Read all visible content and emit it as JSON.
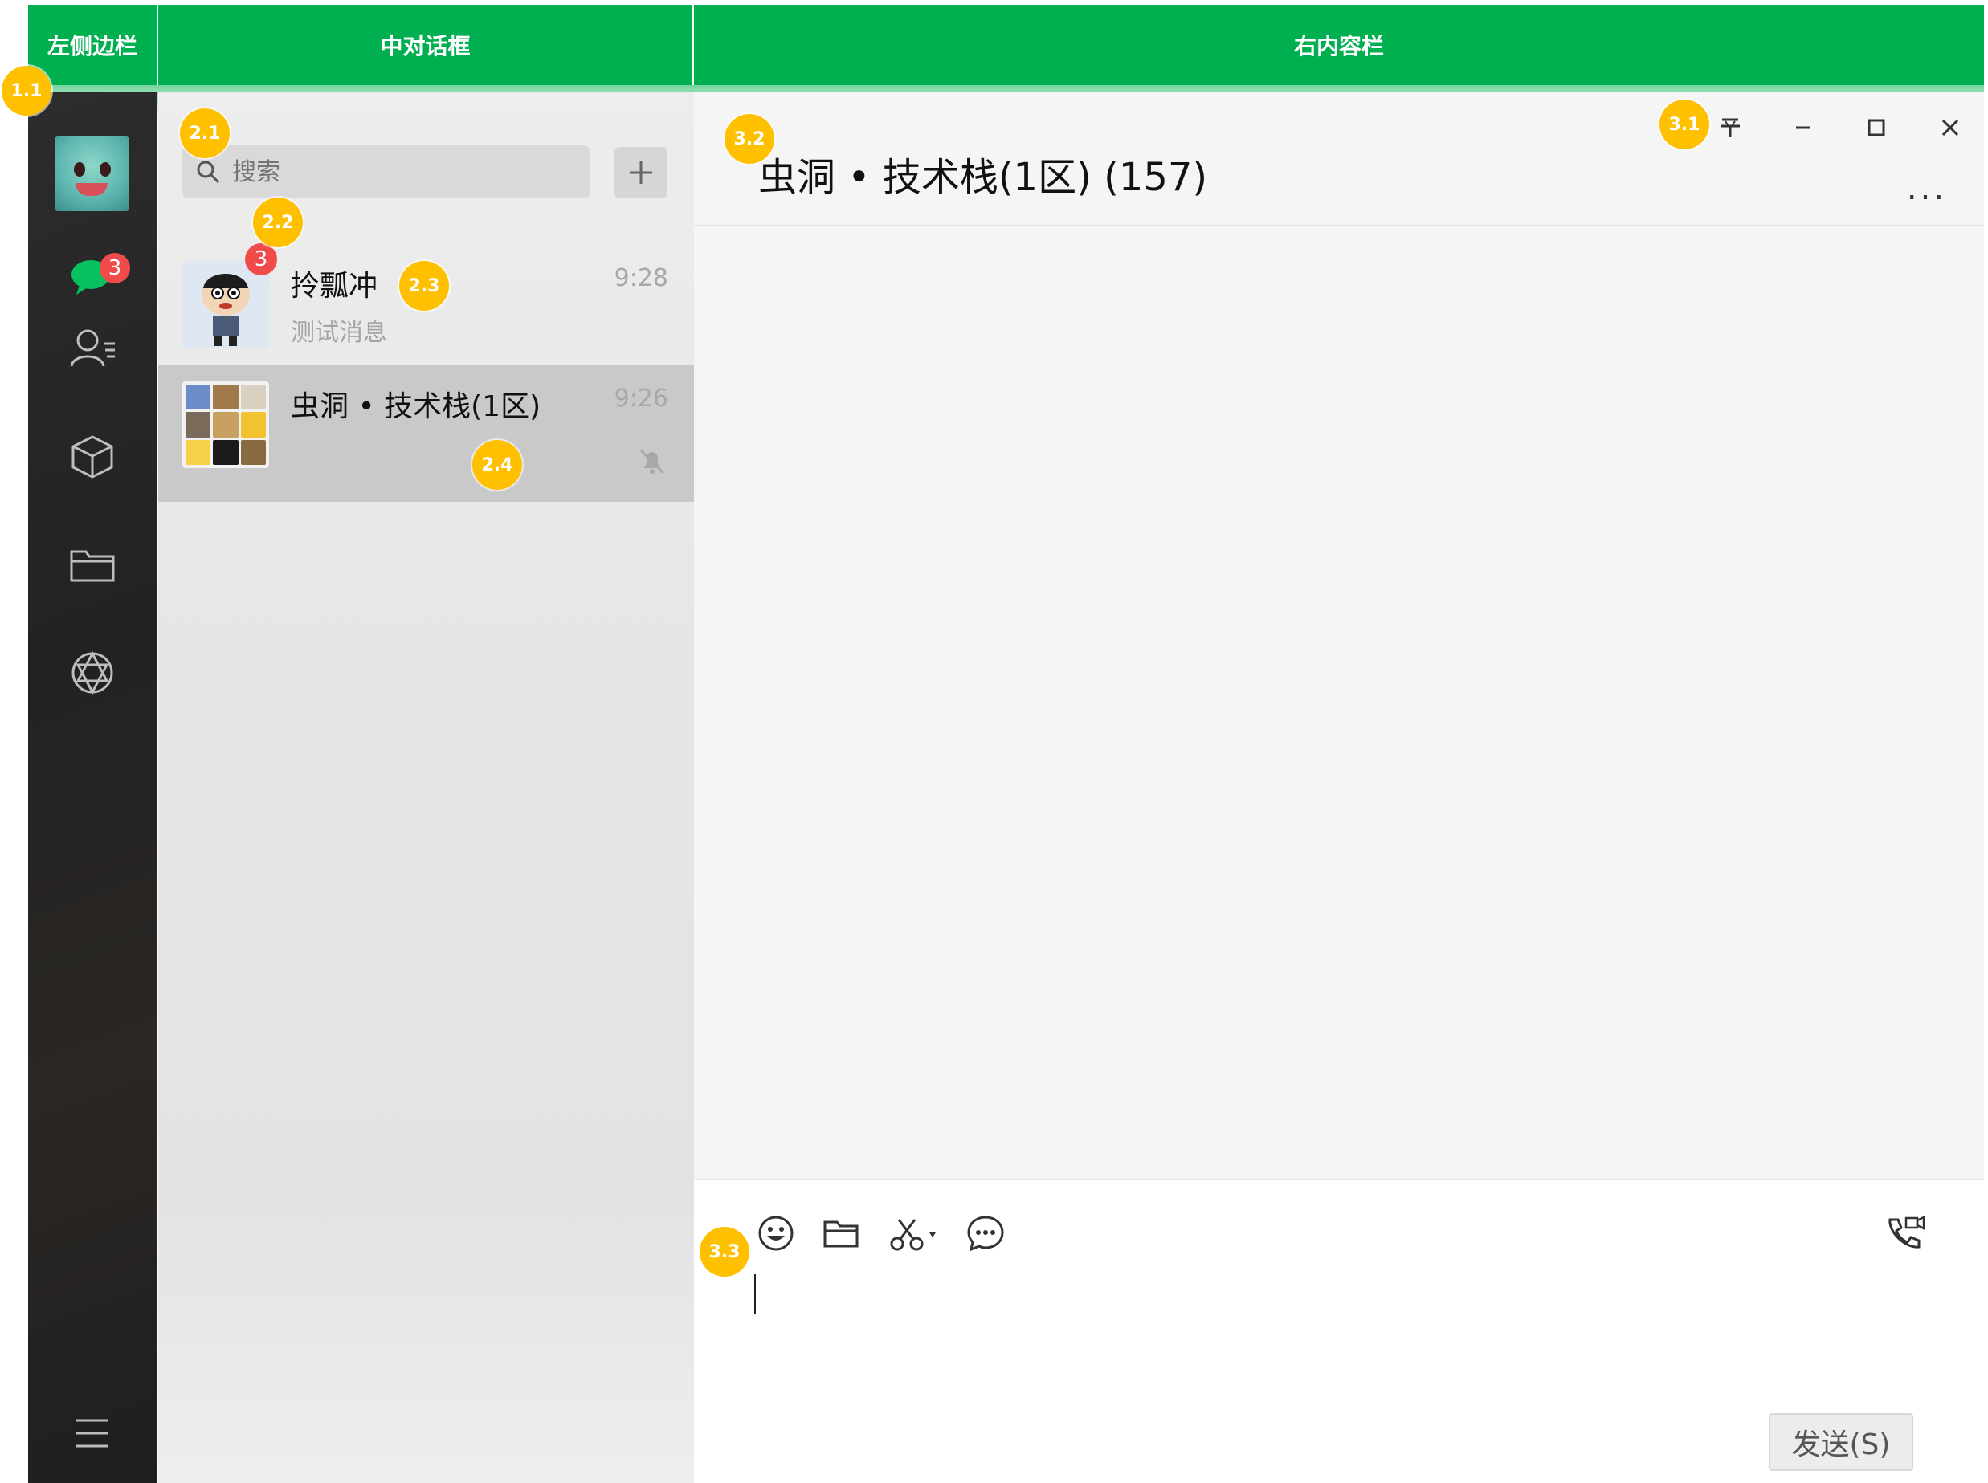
{
  "header": {
    "left_label": "左侧边栏",
    "middle_label": "中对话框",
    "right_label": "右内容栏"
  },
  "markers": {
    "m11": "1.1",
    "m21": "2.1",
    "m22": "2.2",
    "m23": "2.3",
    "m24": "2.4",
    "m31": "3.1",
    "m32": "3.2",
    "m33": "3.3"
  },
  "sidebar": {
    "avatar_icon": "squirtle-avatar",
    "unread_badge": "3",
    "items": [
      {
        "icon": "chat-icon"
      },
      {
        "icon": "contacts-icon"
      },
      {
        "icon": "cube-icon"
      },
      {
        "icon": "folder-icon"
      },
      {
        "icon": "network-icon"
      }
    ],
    "menu_icon": "menu-icon"
  },
  "search": {
    "placeholder": "搜索",
    "add_icon": "plus-icon"
  },
  "conversations": [
    {
      "name": "拎瓢冲",
      "time": "9:28",
      "preview": "测试消息",
      "badge": "3",
      "avatar_icon": "cartoon-avatar"
    },
    {
      "name": "虫洞 • 技术栈(1区)",
      "time": "9:26",
      "muted_icon": "bell-off-icon",
      "avatar_icon": "group-grid-avatar"
    }
  ],
  "chat": {
    "title": "虫洞 • 技术栈(1区) (157)",
    "more_label": "...",
    "window_icons": [
      "pin-icon",
      "minimize-icon",
      "maximize-icon",
      "close-icon"
    ]
  },
  "input": {
    "tools": [
      "emoji-icon",
      "file-icon",
      "scissors-icon",
      "chat-history-icon"
    ],
    "call_icon": "video-call-icon",
    "send_label": "发送(S)"
  },
  "colors": {
    "header_green": "#00b050",
    "marker_yellow": "#ffc000",
    "badge_red": "#f04a4a",
    "chat_green": "#07c160"
  }
}
